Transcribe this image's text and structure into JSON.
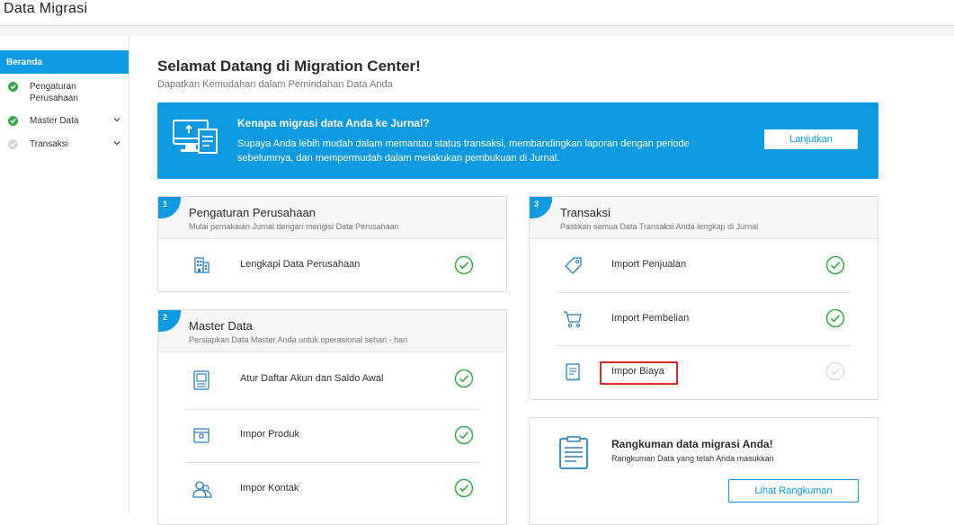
{
  "app": {
    "title": "Data Migrasi"
  },
  "sidebar": {
    "active": "Beranda",
    "items": [
      {
        "label": "Pengaturan Perusahaan",
        "line1": "Pengaturan",
        "line2": "Perusahaan",
        "status": "done",
        "expandable": false
      },
      {
        "label": "Master Data",
        "status": "done",
        "expandable": true
      },
      {
        "label": "Transaksi",
        "status": "pending",
        "expandable": true
      }
    ]
  },
  "main": {
    "title": "Selamat Datang di Migration Center!",
    "subtitle": "Dapatkan Kemudahan dalam Pemindahan Data Anda"
  },
  "banner": {
    "heading": "Kenapa migrasi data Anda ke Jurnal?",
    "text": "Supaya Anda lebih mudah dalam memantau status transaksi, membandingkan laporan dengan periode sebelumnya, dan mempermudah dalam melakukan pembukuan di Jurnal.",
    "button": "Lanjutkan",
    "color": "#0d9ae0"
  },
  "cards": {
    "pengaturan": {
      "number": "1",
      "title": "Pengaturan Perusahaan",
      "subtitle": "Mulai pemakaian Jurnal dengan mengisi Data Perusahaan",
      "rows": [
        {
          "label": "Lengkapi Data Perusahaan",
          "icon": "building-icon",
          "done": true
        }
      ]
    },
    "master": {
      "number": "2",
      "title": "Master Data",
      "subtitle": "Persiapkan Data Master Anda untuk operasional sehari - hari",
      "rows": [
        {
          "label": "Atur Daftar Akun dan Saldo Awal",
          "icon": "ledger-icon",
          "done": true
        },
        {
          "label": "Impor Produk",
          "icon": "box-icon",
          "done": true
        },
        {
          "label": "Impor Kontak",
          "icon": "contacts-icon",
          "done": true
        }
      ]
    },
    "transaksi": {
      "number": "3",
      "title": "Transaksi",
      "subtitle": "Pastikan semua Data Transaksi Anda lengkap di Jurnal",
      "rows": [
        {
          "label": "Import Penjualan",
          "icon": "tag-icon",
          "done": true
        },
        {
          "label": "Import Pembelian",
          "icon": "cart-icon",
          "done": true
        },
        {
          "label": "Impor Biaya",
          "icon": "receipt-icon",
          "done": false
        }
      ]
    }
  },
  "summary": {
    "title": "Rangkuman data migrasi Anda!",
    "subtitle": "Rangkuman Data yang telah Anda masukkan",
    "button": "Lihat Rangkuman"
  },
  "colors": {
    "accent": "#0d9ae0",
    "success": "#3aaa4c",
    "highlight": "#d32f2f"
  }
}
